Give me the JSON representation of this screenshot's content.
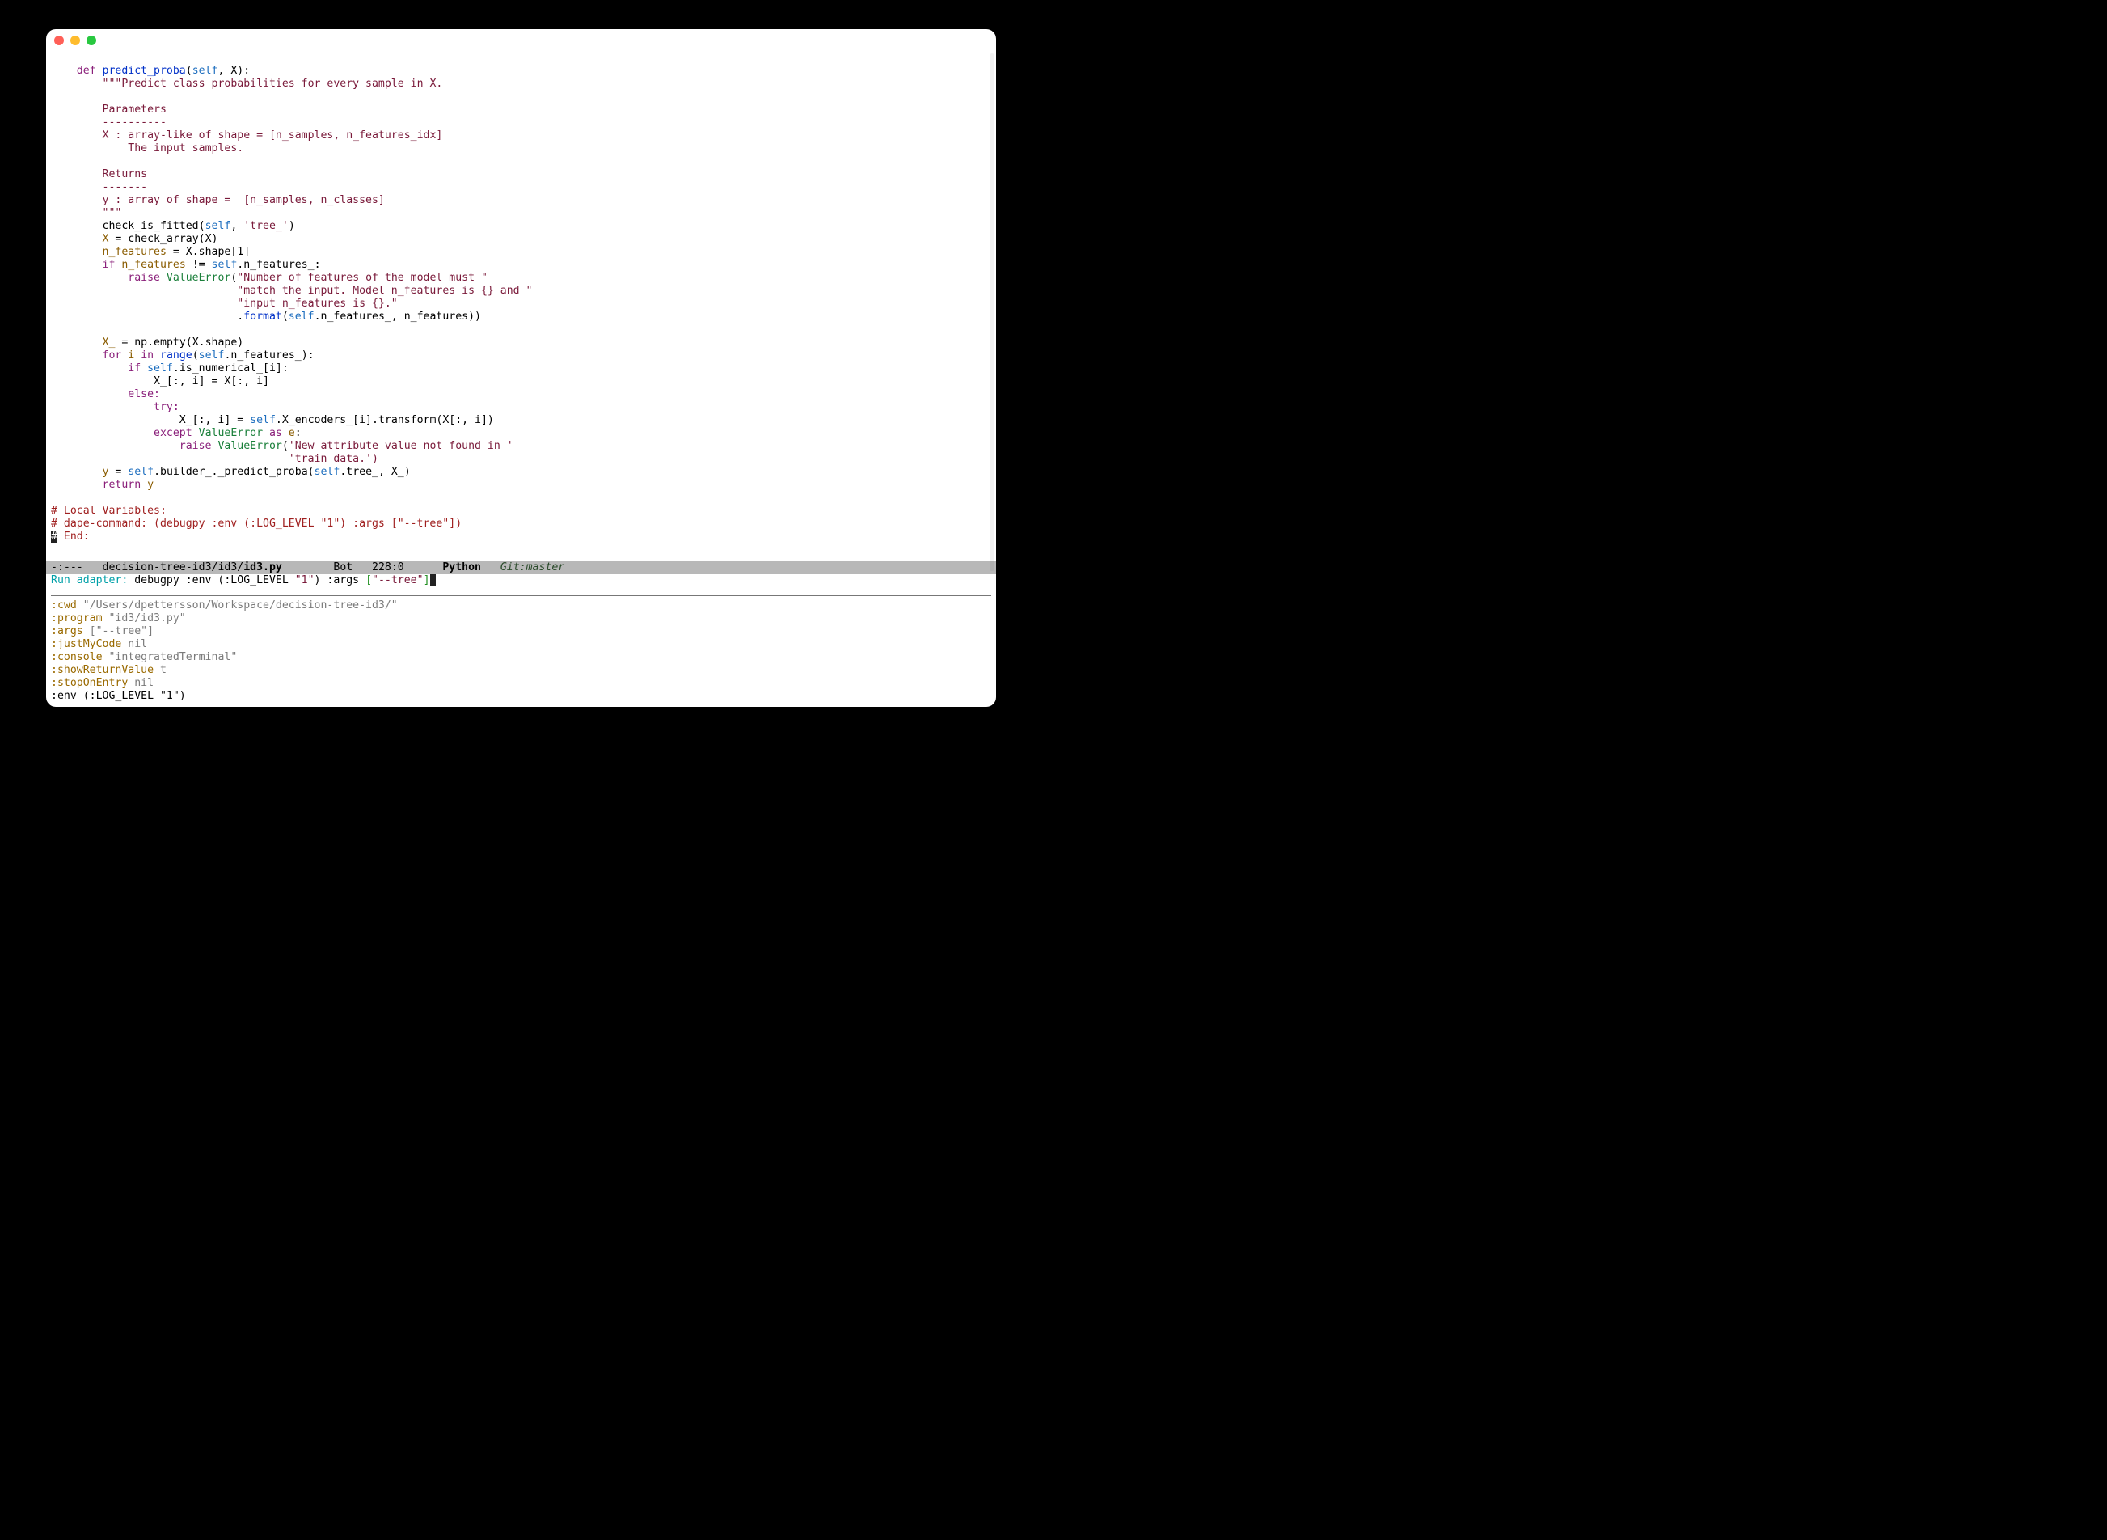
{
  "traffic_lights": [
    "close",
    "minimize",
    "zoom"
  ],
  "code": {
    "l01": {
      "kw": "def ",
      "fn": "predict_proba",
      "slf": "self",
      "tail": ", X):"
    },
    "l02": "\"\"\"Predict class probabilities for every sample in X.",
    "l03": "",
    "l04": "Parameters",
    "l05": "----------",
    "l06": "X : array-like of shape = [n_samples, n_features_idx]",
    "l07": "    The input samples.",
    "l08": "",
    "l09": "Returns",
    "l10": "-------",
    "l11": "y : array of shape =  [n_samples, n_classes]",
    "l12": "\"\"\"",
    "l13": {
      "call": "check_is_fitted(",
      "slf": "self",
      "tail": ", ",
      "lit": "'tree_'",
      "end": ")"
    },
    "l14": {
      "var": "X",
      "rest": " = check_array(X)"
    },
    "l15": {
      "var": "n_features",
      "rest": " = X.shape[1]"
    },
    "l16": {
      "kw": "if ",
      "var": "n_features",
      "mid": " != ",
      "slf": "self",
      "attr": ".n_features_:"
    },
    "l17": {
      "kw": "raise ",
      "exc": "ValueError",
      "open": "(",
      "lit": "\"Number of features of the model must \""
    },
    "l18": "\"match the input. Model n_features is {} and \"",
    "l19": "\"input n_features is {}.\"",
    "l20": {
      "pre": ".",
      "fn": "format",
      "open": "(",
      "slf": "self",
      "rest": ".n_features_, n_features))"
    },
    "l21": "",
    "l22": {
      "var": "X_",
      "rest": " = np.empty(X.shape)"
    },
    "l23": {
      "kw": "for ",
      "it": "i",
      "kw2": " in ",
      "fn": "range",
      "open": "(",
      "slf": "self",
      "rest": ".n_features_):"
    },
    "l24": {
      "kw": "if ",
      "slf": "self",
      "rest": ".is_numerical_[i]:"
    },
    "l25": "X_[:, i] = X[:, i]",
    "l26": "else:",
    "l27": "try:",
    "l28": {
      "pre": "X_[:, i] = ",
      "slf": "self",
      "rest": ".X_encoders_[i].transform(X[:, i])"
    },
    "l29": {
      "kw": "except ",
      "exc": "ValueError",
      "kw2": " as ",
      "var": "e",
      "end": ":"
    },
    "l30": {
      "kw": "raise ",
      "exc": "ValueError",
      "open": "(",
      "lit": "'New attribute value not found in '"
    },
    "l31": "'train data.')",
    "l32": {
      "var": "y",
      "rest": " = ",
      "slf": "self",
      "rest2": ".builder_._predict_proba(",
      "slf2": "self",
      "rest3": ".tree_, X_)"
    },
    "l33": {
      "kw": "return ",
      "var": "y"
    },
    "l34": "# Local Variables:",
    "l35": "# dape-command: (debugpy :env (:LOG_LEVEL \"1\") :args [\"--tree\"])",
    "l36": {
      "mark": "#",
      "rest": " End:"
    }
  },
  "modeline": {
    "flags": "-:---   ",
    "path_prefix": "decision-tree-id3/id3/",
    "file": "id3.py",
    "gap": "        ",
    "pos": "Bot   228:0",
    "gap2": "      ",
    "mode": "Python",
    "gap3": "   ",
    "vc": "Git:master"
  },
  "minibuffer": {
    "prompt": "Run adapter: ",
    "body1": "debugpy :env (:LOG_LEVEL ",
    "lit1": "\"1\"",
    "body2": ") :args ",
    "open": "[",
    "lit2": "\"--tree\"",
    "close": "]"
  },
  "output": {
    "r1": {
      "k": ":cwd ",
      "v": "\"/Users/dpettersson/Workspace/decision-tree-id3/\""
    },
    "r2": {
      "k": ":program ",
      "v": "\"id3/id3.py\""
    },
    "r3": {
      "k": ":args ",
      "v": "[\"--tree\"]"
    },
    "r4": {
      "k": ":justMyCode ",
      "v": "nil"
    },
    "r5": {
      "k": ":console ",
      "v": "\"integratedTerminal\""
    },
    "r6": {
      "k": ":showReturnValue ",
      "v": "t"
    },
    "r7": {
      "k": ":stopOnEntry ",
      "v": "nil"
    },
    "r8": {
      "k": ":env ",
      "v": "(:LOG_LEVEL \"1\")"
    }
  }
}
